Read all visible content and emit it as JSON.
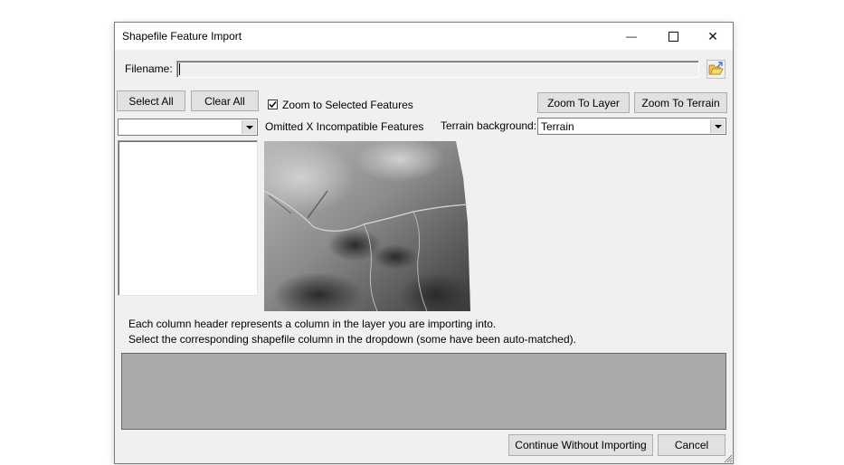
{
  "window": {
    "title": "Shapefile Feature Import",
    "minimize_glyph": "—",
    "maximize_glyph": "☐",
    "close_glyph": "✕"
  },
  "filename": {
    "label": "Filename:",
    "value": "",
    "browse_icon": "folder-open-icon"
  },
  "toolbar": {
    "select_all": "Select All",
    "clear_all": "Clear All",
    "zoom_selected_label": "Zoom to Selected Features",
    "zoom_selected_checked": true,
    "zoom_to_layer": "Zoom To Layer",
    "zoom_to_terrain": "Zoom To Terrain"
  },
  "feature_combo": {
    "value": ""
  },
  "omitted_text": "Omitted X Incompatible Features",
  "terrain": {
    "label": "Terrain background:",
    "value": "Terrain"
  },
  "instructions": {
    "line1": "Each column header represents a column in the layer you are importing into.",
    "line2": "Select the corresponding shapefile column in the dropdown (some have been auto-matched)."
  },
  "footer": {
    "continue_label": "Continue Without Importing",
    "cancel_label": "Cancel"
  },
  "colors": {
    "window_bg": "#f0f0f0",
    "button_bg": "#e1e1e1",
    "grid_bg": "#aaaaaa"
  }
}
